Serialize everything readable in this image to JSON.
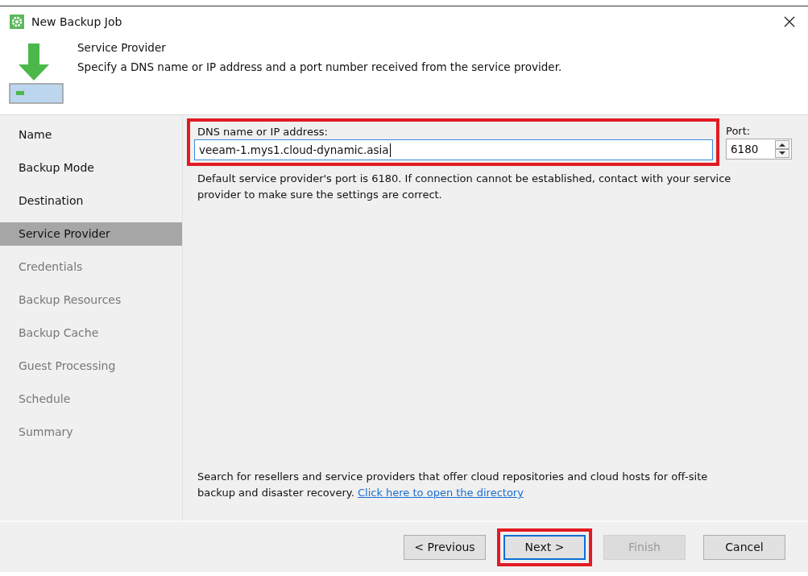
{
  "window": {
    "title": "New Backup Job"
  },
  "header": {
    "title": "Service Provider",
    "description": "Specify a DNS name or IP address and a port number received from the service provider."
  },
  "steps": [
    {
      "label": "Name",
      "selected": false,
      "enabled": true
    },
    {
      "label": "Backup Mode",
      "selected": false,
      "enabled": true
    },
    {
      "label": "Destination",
      "selected": false,
      "enabled": true
    },
    {
      "label": "Service Provider",
      "selected": true,
      "enabled": true
    },
    {
      "label": "Credentials",
      "selected": false,
      "enabled": false
    },
    {
      "label": "Backup Resources",
      "selected": false,
      "enabled": false
    },
    {
      "label": "Backup Cache",
      "selected": false,
      "enabled": false
    },
    {
      "label": "Guest Processing",
      "selected": false,
      "enabled": false
    },
    {
      "label": "Schedule",
      "selected": false,
      "enabled": false
    },
    {
      "label": "Summary",
      "selected": false,
      "enabled": false
    }
  ],
  "address": {
    "label": "DNS name or IP address:",
    "value": "veeam-1.mys1.cloud-dynamic.asia",
    "highlighted": true
  },
  "port": {
    "label": "Port:",
    "value": "6180"
  },
  "hint": "Default service provider's port is 6180. If connection cannot be established, contact with your service provider to make sure the settings are correct.",
  "directory": {
    "text": "Search for resellers and service providers that offer cloud repositories and cloud hosts for off-site backup and disaster recovery.",
    "link": "Click here to open the directory"
  },
  "buttons": [
    {
      "label": "< Previous",
      "disabled": false,
      "highlighted": false
    },
    {
      "label": "Next >",
      "disabled": false,
      "highlighted": true
    },
    {
      "label": "Finish",
      "disabled": true,
      "highlighted": false
    },
    {
      "label": "Cancel",
      "disabled": false,
      "highlighted": false
    }
  ]
}
